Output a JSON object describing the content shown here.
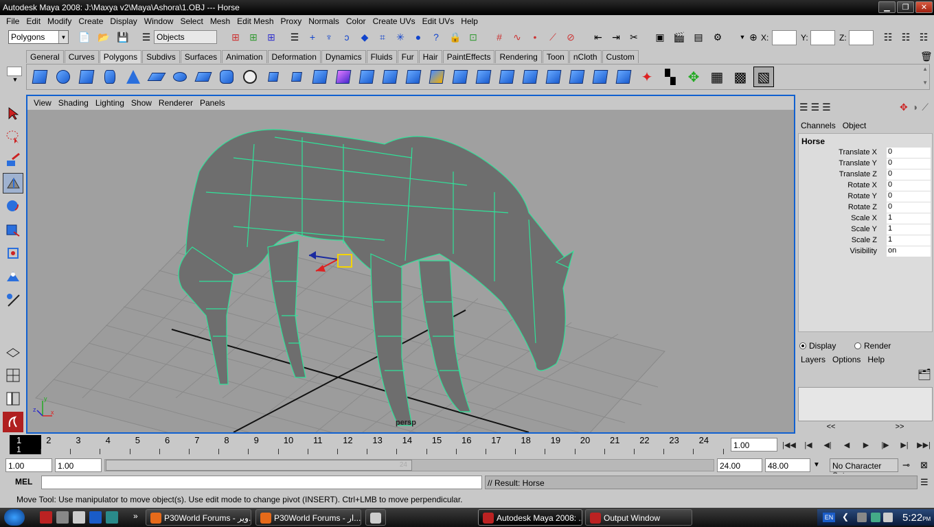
{
  "window": {
    "title": "Autodesk Maya 2008: J:\\Maxya v2\\Maya\\Ashora\\1.OBJ  ---  Horse"
  },
  "menubar": [
    "File",
    "Edit",
    "Modify",
    "Create",
    "Display",
    "Window",
    "Select",
    "Mesh",
    "Edit Mesh",
    "Proxy",
    "Normals",
    "Color",
    "Create UVs",
    "Edit UVs",
    "Help"
  ],
  "statusline": {
    "mode": "Polygons",
    "selection_field": "Objects",
    "x_label": "X:",
    "y_label": "Y:",
    "z_label": "Z:"
  },
  "shelf_tabs": [
    "General",
    "Curves",
    "Polygons",
    "Subdivs",
    "Surfaces",
    "Animation",
    "Deformation",
    "Dynamics",
    "Fluids",
    "Fur",
    "Hair",
    "PaintEffects",
    "Rendering",
    "Toon",
    "nCloth",
    "Custom"
  ],
  "shelf_tab_active": "Polygons",
  "panel_menu": [
    "View",
    "Shading",
    "Lighting",
    "Show",
    "Renderer",
    "Panels"
  ],
  "viewport": {
    "camera": "persp"
  },
  "channel_box": {
    "tabs": [
      "Channels",
      "Object"
    ],
    "object": "Horse",
    "channels": [
      {
        "label": "Translate X",
        "value": "0"
      },
      {
        "label": "Translate Y",
        "value": "0"
      },
      {
        "label": "Translate Z",
        "value": "0"
      },
      {
        "label": "Rotate X",
        "value": "0"
      },
      {
        "label": "Rotate Y",
        "value": "0"
      },
      {
        "label": "Rotate Z",
        "value": "0"
      },
      {
        "label": "Scale X",
        "value": "1"
      },
      {
        "label": "Scale Y",
        "value": "1"
      },
      {
        "label": "Scale Z",
        "value": "1"
      },
      {
        "label": "Visibility",
        "value": "on"
      }
    ],
    "display_label": "Display",
    "render_label": "Render",
    "layer_menu": [
      "Layers",
      "Options",
      "Help"
    ],
    "scroll_left": "<<",
    "scroll_right": ">>"
  },
  "timeline": {
    "frames": [
      "1",
      "2",
      "3",
      "4",
      "5",
      "6",
      "7",
      "8",
      "9",
      "10",
      "11",
      "12",
      "13",
      "14",
      "15",
      "16",
      "17",
      "18",
      "19",
      "20",
      "21",
      "22",
      "23",
      "24"
    ],
    "current_frame_top": "1",
    "current_frame_bottom": "1",
    "current_time": "1.00"
  },
  "range": {
    "start": "1.00",
    "playback_start": "1.00",
    "thumb_label": "24",
    "playback_end": "24.00",
    "end": "48.00",
    "character_set": "No Character Set"
  },
  "command": {
    "label": "MEL",
    "result": "// Result: Horse"
  },
  "help_line": "Move Tool: Use manipulator to move object(s). Use edit mode to change pivot (INSERT).  Ctrl+LMB to move perpendicular.",
  "taskbar": {
    "tasks": [
      {
        "label": "P30World Forums - ویر..."
      },
      {
        "label": "P30World Forums - ار..."
      },
      {
        "label": ""
      },
      {
        "label": "Autodesk Maya 2008: ..."
      },
      {
        "label": "Output Window"
      }
    ],
    "lang": "EN",
    "time": "5:22",
    "ampm": "PM"
  },
  "colors": {
    "wireframe": "#2fe39a",
    "mesh_face": "#777777",
    "viewport_bg": "#a0a0a0",
    "active_panel_border": "#1060d0"
  }
}
